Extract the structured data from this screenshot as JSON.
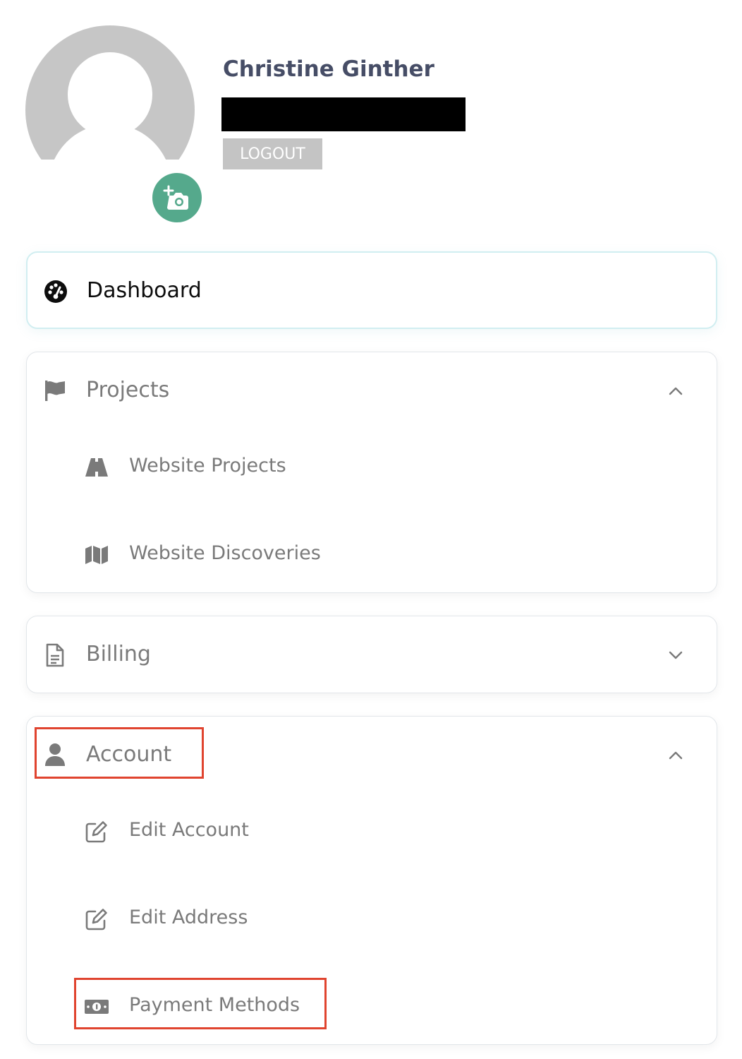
{
  "profile": {
    "name": "Christine Ginther",
    "logout_label": "LOGOUT"
  },
  "nav": {
    "dashboard": {
      "label": "Dashboard",
      "icon": "dashboard-gauge-icon"
    },
    "projects": {
      "label": "Projects",
      "icon": "flag-icon",
      "expanded": true,
      "items": [
        {
          "label": "Website Projects",
          "icon": "road-icon"
        },
        {
          "label": "Website Discoveries",
          "icon": "map-icon"
        }
      ]
    },
    "billing": {
      "label": "Billing",
      "icon": "document-icon",
      "expanded": false
    },
    "account": {
      "label": "Account",
      "icon": "user-icon",
      "expanded": true,
      "items": [
        {
          "label": "Edit Account",
          "icon": "edit-icon"
        },
        {
          "label": "Edit Address",
          "icon": "edit-icon"
        },
        {
          "label": "Payment Methods",
          "icon": "money-bill-icon"
        }
      ]
    }
  },
  "colors": {
    "accent_green": "#55a98c",
    "name_text": "#464d66",
    "muted_text": "#7a7a7a",
    "highlight_red": "#e0442f"
  }
}
